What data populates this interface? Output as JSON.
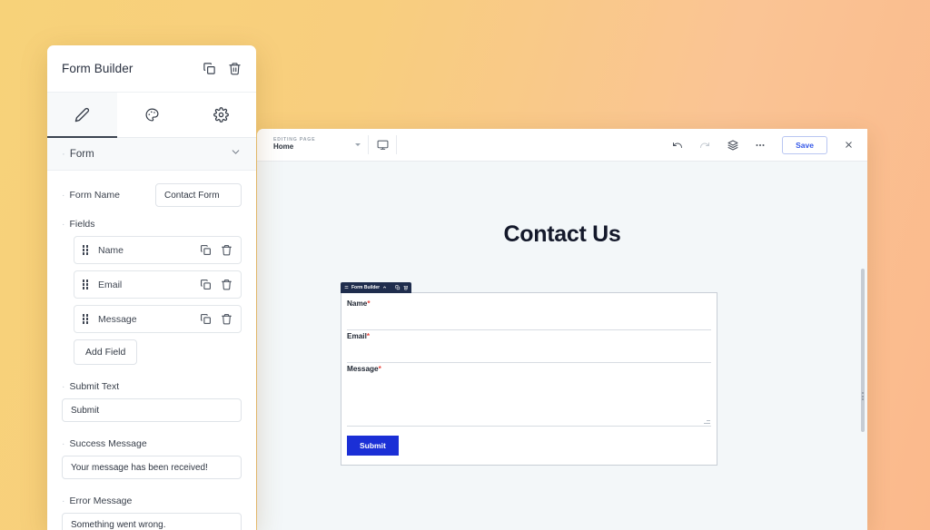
{
  "background": {
    "gradient_from": "#f7d279",
    "gradient_to": "#fbb98c"
  },
  "sidebar": {
    "title": "Form Builder",
    "header_icons": [
      {
        "name": "duplicate-icon",
        "label": "Duplicate"
      },
      {
        "name": "trash-icon",
        "label": "Delete"
      }
    ],
    "tabs": [
      {
        "id": "content",
        "icon": "pencil-icon",
        "label": "Content",
        "active": true
      },
      {
        "id": "design",
        "icon": "palette-icon",
        "label": "Design",
        "active": false
      },
      {
        "id": "settings",
        "icon": "gear-icon",
        "label": "Settings",
        "active": false
      }
    ],
    "section": {
      "title": "Form",
      "chevron": "chevron-down-icon",
      "expanded": true
    },
    "form_name": {
      "label": "Form Name",
      "value": "Contact Form"
    },
    "fields_label": "Fields",
    "fields": [
      {
        "name": "Name"
      },
      {
        "name": "Email"
      },
      {
        "name": "Message"
      }
    ],
    "add_field_label": "Add Field",
    "submit_text": {
      "label": "Submit Text",
      "value": "Submit"
    },
    "success_message": {
      "label": "Success Message",
      "value": "Your message has been received!"
    },
    "error_message": {
      "label": "Error Message",
      "value": "Something went wrong."
    }
  },
  "editor": {
    "toolbar": {
      "page_kicker": "EDITING PAGE",
      "page_name": "Home",
      "device_icon": "desktop-icon",
      "undo_icon": "undo-icon",
      "redo_icon": "redo-icon",
      "layers_icon": "layers-icon",
      "more_icon": "more-horizontal-icon",
      "save_label": "Save",
      "close_icon": "close-icon"
    },
    "canvas": {
      "heading": "Contact Us",
      "widget_toolbar": {
        "move_icon": "move-icon",
        "label": "Form Builder",
        "chevron_icon": "chevron-up-icon",
        "duplicate_icon": "duplicate-icon",
        "trash_icon": "trash-icon"
      },
      "form": {
        "fields": [
          {
            "label": "Name",
            "required": true,
            "type": "input"
          },
          {
            "label": "Email",
            "required": true,
            "type": "input"
          },
          {
            "label": "Message",
            "required": true,
            "type": "textarea"
          }
        ],
        "required_marker": "*",
        "submit_label": "Submit",
        "submit_color": "#1b2fd6"
      }
    }
  }
}
